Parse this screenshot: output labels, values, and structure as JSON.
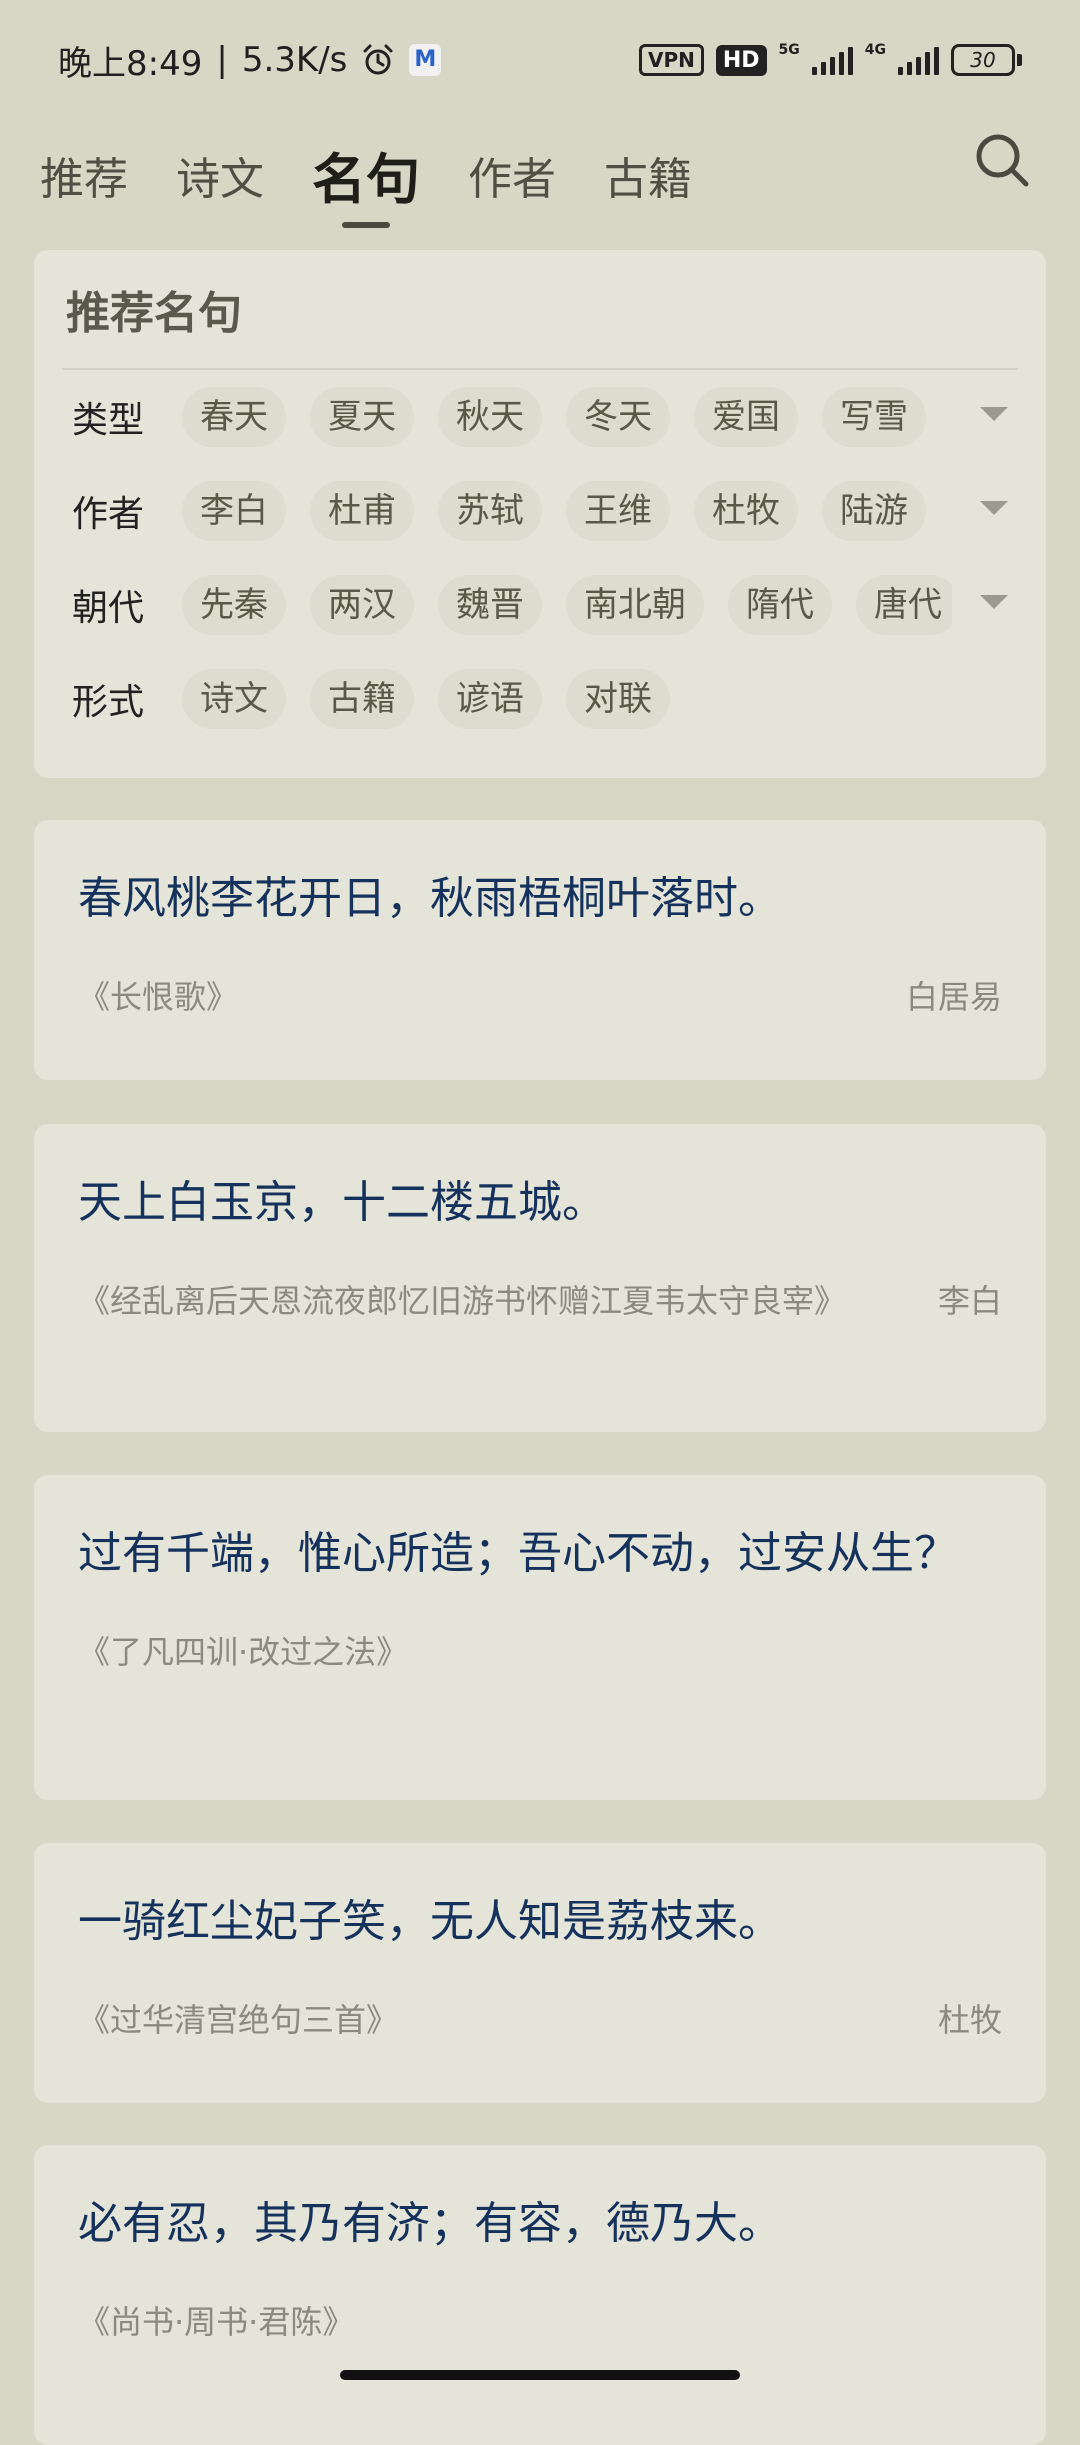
{
  "status": {
    "time": "晚上8:49",
    "speed": "5.3K/s",
    "vpn": "VPN",
    "hd": "HD",
    "net1": "5G",
    "net2": "4G",
    "battery": "30"
  },
  "tabs": [
    {
      "label": "推荐"
    },
    {
      "label": "诗文"
    },
    {
      "label": "名句"
    },
    {
      "label": "作者"
    },
    {
      "label": "古籍"
    }
  ],
  "filter": {
    "title": "推荐名句",
    "rows": [
      {
        "label": "类型",
        "chips": [
          "春天",
          "夏天",
          "秋天",
          "冬天",
          "爱国",
          "写雪"
        ]
      },
      {
        "label": "作者",
        "chips": [
          "李白",
          "杜甫",
          "苏轼",
          "王维",
          "杜牧",
          "陆游"
        ]
      },
      {
        "label": "朝代",
        "chips": [
          "先秦",
          "两汉",
          "魏晋",
          "南北朝",
          "隋代",
          "唐代"
        ]
      },
      {
        "label": "形式",
        "chips": [
          "诗文",
          "古籍",
          "谚语",
          "对联"
        ]
      }
    ]
  },
  "quotes": [
    {
      "text": "春风桃李花开日，秋雨梧桐叶落时。",
      "source": "《长恨歌》",
      "author": "白居易"
    },
    {
      "text": "天上白玉京，十二楼五城。",
      "source": "《经乱离后天恩流夜郎忆旧游书怀赠江夏韦太守良宰》",
      "author": "李白"
    },
    {
      "text": "过有千端，惟心所造；吾心不动，过安从生？",
      "source": "《了凡四训·改过之法》",
      "author": ""
    },
    {
      "text": "一骑红尘妃子笑，无人知是荔枝来。",
      "source": "《过华清宫绝句三首》",
      "author": "杜牧"
    },
    {
      "text": "必有忍，其乃有济；有容，德乃大。",
      "source": "《尚书·周书·君陈》",
      "author": ""
    }
  ]
}
